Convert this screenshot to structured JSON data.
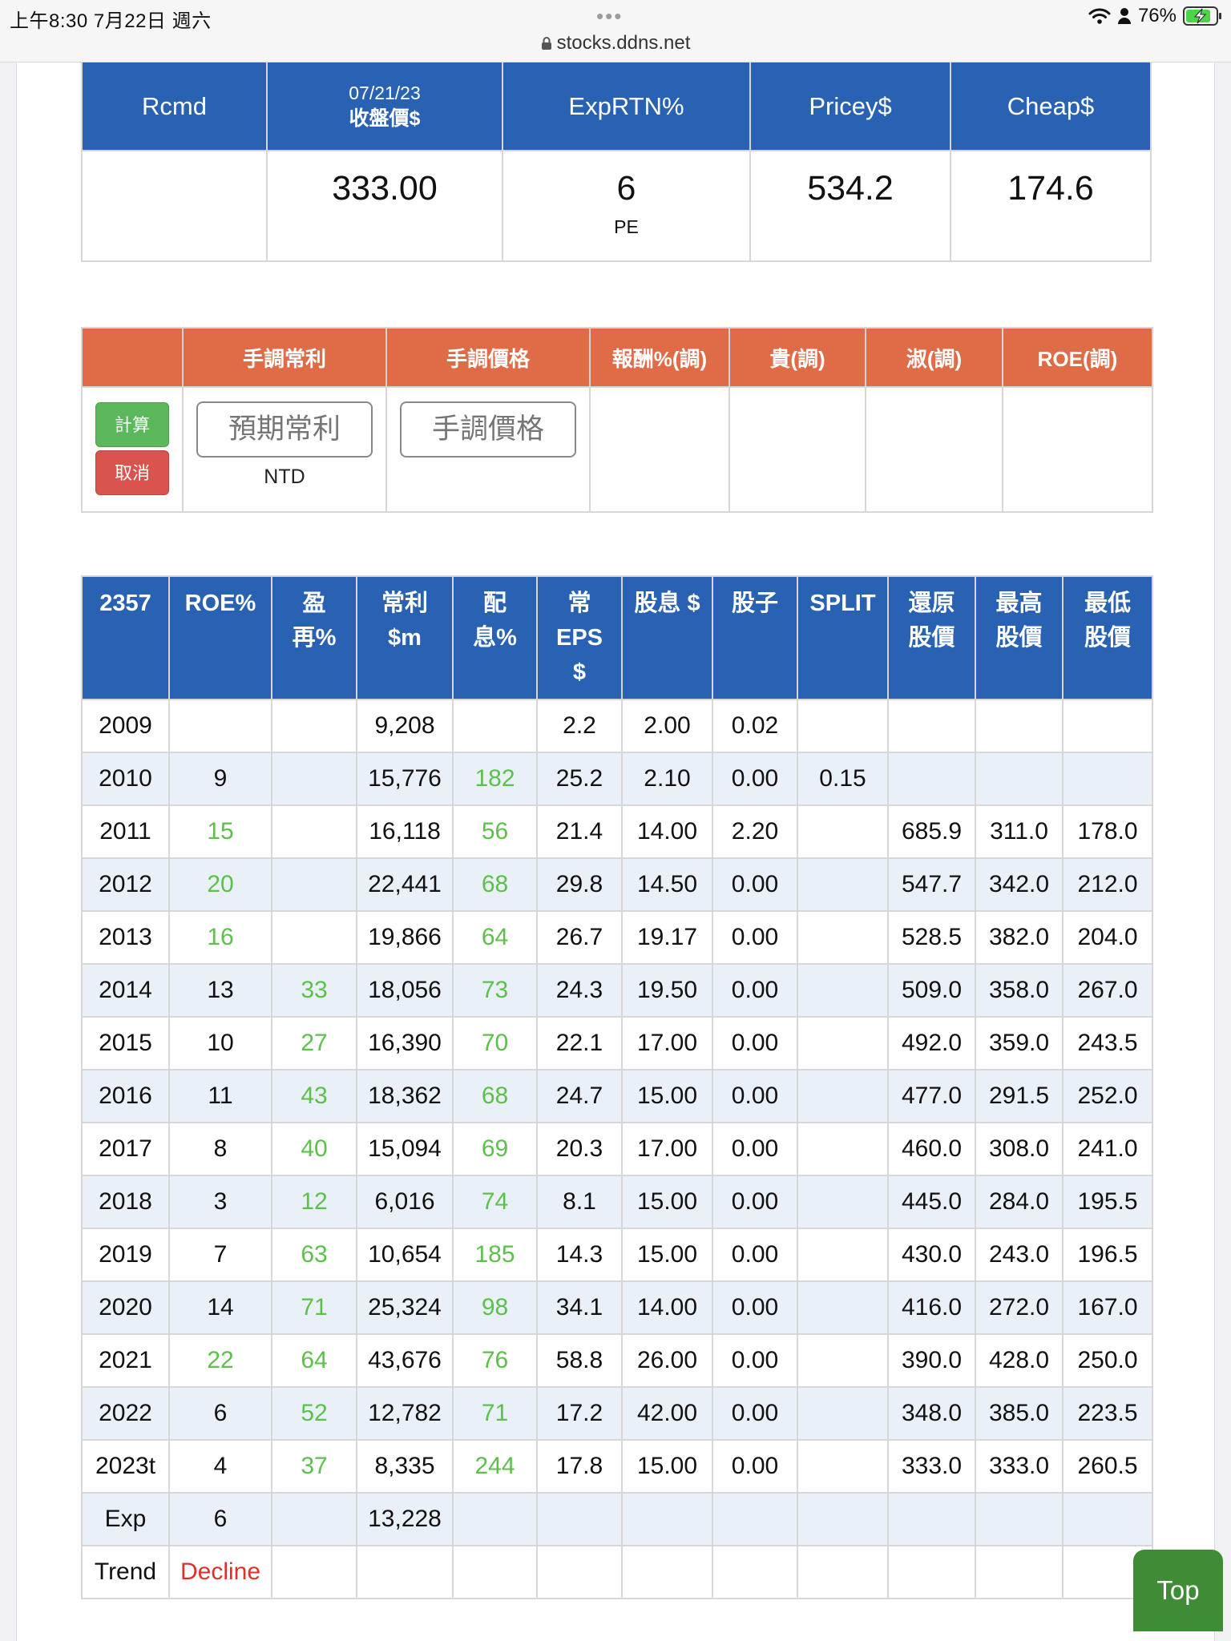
{
  "status": {
    "time": "上午8:30   7月22日 週六",
    "battery": "76%",
    "url": "stocks.ddns.net"
  },
  "summary": {
    "headers": {
      "rcmd": "Rcmd",
      "date": "07/21/23",
      "close_price": "收盤價$",
      "exp_rtn": "ExpRTN%",
      "pricey": "Pricey$",
      "cheap": "Cheap$"
    },
    "values": {
      "rcmd": "",
      "close_price": "333.00",
      "exp_rtn": "6",
      "exp_rtn_sub": "PE",
      "pricey": "534.2",
      "cheap": "174.6"
    }
  },
  "adjust": {
    "headers": [
      "",
      "手調常利",
      "手調價格",
      "報酬%(調)",
      "貴(調)",
      "淑(調)",
      "ROE(調)"
    ],
    "calc_button": "計算",
    "cancel_button": "取消",
    "profit_placeholder": "預期常利",
    "price_placeholder": "手調價格",
    "unit": "NTD"
  },
  "history": {
    "headers": [
      "2357",
      "ROE%",
      "盈\n再%",
      "常利\n$m",
      "配\n息%",
      "常\nEPS\n$",
      "股息 $",
      "股子",
      "SPLIT",
      "還原\n股價",
      "最高\n股價",
      "最低\n股價"
    ],
    "rows": [
      [
        "2009",
        "",
        "",
        "9,208",
        "",
        "2.2",
        "2.00",
        "0.02",
        "",
        "",
        "",
        ""
      ],
      [
        "2010",
        "9",
        "",
        "15,776",
        "182",
        "25.2",
        "2.10",
        "0.00",
        "0.15",
        "",
        "",
        ""
      ],
      [
        "2011",
        "15",
        "",
        "16,118",
        "56",
        "21.4",
        "14.00",
        "2.20",
        "",
        "685.9",
        "311.0",
        "178.0"
      ],
      [
        "2012",
        "20",
        "",
        "22,441",
        "68",
        "29.8",
        "14.50",
        "0.00",
        "",
        "547.7",
        "342.0",
        "212.0"
      ],
      [
        "2013",
        "16",
        "",
        "19,866",
        "64",
        "26.7",
        "19.17",
        "0.00",
        "",
        "528.5",
        "382.0",
        "204.0"
      ],
      [
        "2014",
        "13",
        "33",
        "18,056",
        "73",
        "24.3",
        "19.50",
        "0.00",
        "",
        "509.0",
        "358.0",
        "267.0"
      ],
      [
        "2015",
        "10",
        "27",
        "16,390",
        "70",
        "22.1",
        "17.00",
        "0.00",
        "",
        "492.0",
        "359.0",
        "243.5"
      ],
      [
        "2016",
        "11",
        "43",
        "18,362",
        "68",
        "24.7",
        "15.00",
        "0.00",
        "",
        "477.0",
        "291.5",
        "252.0"
      ],
      [
        "2017",
        "8",
        "40",
        "15,094",
        "69",
        "20.3",
        "17.00",
        "0.00",
        "",
        "460.0",
        "308.0",
        "241.0"
      ],
      [
        "2018",
        "3",
        "12",
        "6,016",
        "74",
        "8.1",
        "15.00",
        "0.00",
        "",
        "445.0",
        "284.0",
        "195.5"
      ],
      [
        "2019",
        "7",
        "63",
        "10,654",
        "185",
        "14.3",
        "15.00",
        "0.00",
        "",
        "430.0",
        "243.0",
        "196.5"
      ],
      [
        "2020",
        "14",
        "71",
        "25,324",
        "98",
        "34.1",
        "14.00",
        "0.00",
        "",
        "416.0",
        "272.0",
        "167.0"
      ],
      [
        "2021",
        "22",
        "64",
        "43,676",
        "76",
        "58.8",
        "26.00",
        "0.00",
        "",
        "390.0",
        "428.0",
        "250.0"
      ],
      [
        "2022",
        "6",
        "52",
        "12,782",
        "71",
        "17.2",
        "42.00",
        "0.00",
        "",
        "348.0",
        "385.0",
        "223.5"
      ],
      [
        "2023t",
        "4",
        "37",
        "8,335",
        "244",
        "17.8",
        "15.00",
        "0.00",
        "",
        "333.0",
        "333.0",
        "260.5"
      ],
      [
        "Exp",
        "6",
        "",
        "13,228",
        "",
        "",
        "",
        "",
        "",
        "",
        "",
        ""
      ],
      [
        "Trend",
        "Decline",
        "",
        "",
        "",
        "",
        "",
        "",
        "",
        "",
        "",
        ""
      ]
    ],
    "green_cells": [
      [
        2,
        1
      ],
      [
        3,
        1
      ],
      [
        4,
        1
      ],
      [
        12,
        1
      ],
      [
        5,
        2
      ],
      [
        6,
        2
      ],
      [
        7,
        2
      ],
      [
        8,
        2
      ],
      [
        9,
        2
      ],
      [
        10,
        2
      ],
      [
        11,
        2
      ],
      [
        12,
        2
      ],
      [
        13,
        2
      ],
      [
        14,
        2
      ],
      [
        1,
        4
      ],
      [
        2,
        4
      ],
      [
        3,
        4
      ],
      [
        4,
        4
      ],
      [
        5,
        4
      ],
      [
        6,
        4
      ],
      [
        7,
        4
      ],
      [
        8,
        4
      ],
      [
        9,
        4
      ],
      [
        10,
        4
      ],
      [
        11,
        4
      ],
      [
        12,
        4
      ],
      [
        13,
        4
      ],
      [
        14,
        4
      ]
    ],
    "red_cells": [
      [
        16,
        1
      ]
    ]
  },
  "top_button": "Top",
  "colors": {
    "blue_header": "#2a62b3",
    "orange_header": "#e06b47",
    "green_text": "#5cc14a",
    "red_text": "#e0302a",
    "top_button": "#3f8c36"
  }
}
